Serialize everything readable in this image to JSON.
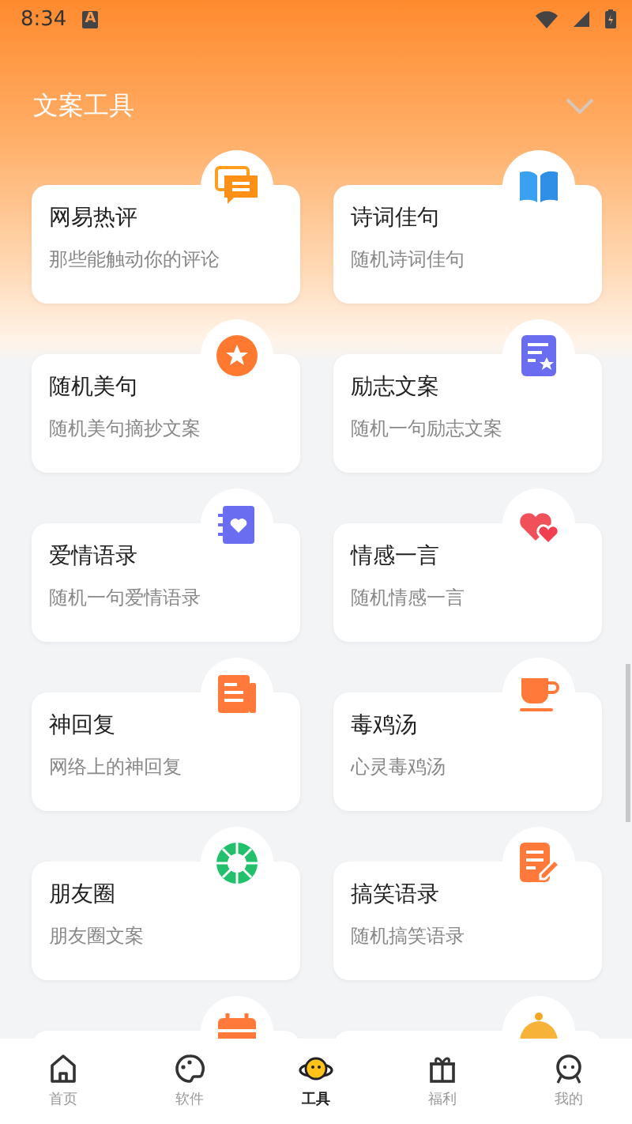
{
  "status_bar": {
    "time": "8:34",
    "notification": "A"
  },
  "header": {
    "title": "文案工具",
    "expanded": false
  },
  "cards": [
    {
      "kind": "full",
      "title": "网易热评",
      "subtitle": "那些能触动你的评论"
    },
    {
      "kind": "full",
      "title": "诗词佳句",
      "subtitle": "随机诗词佳句"
    },
    {
      "kind": "full",
      "title": "随机美句",
      "subtitle": "随机美句摘抄文案"
    },
    {
      "kind": "full",
      "title": "励志文案",
      "subtitle": "随机一句励志文案"
    },
    {
      "kind": "full",
      "title": "爱情语录",
      "subtitle": "随机一句爱情语录"
    },
    {
      "kind": "full",
      "title": "情感一言",
      "subtitle": "随机情感一言"
    },
    {
      "kind": "full",
      "title": "神回复",
      "subtitle": "网络上的神回复"
    },
    {
      "kind": "full",
      "title": "毒鸡汤",
      "subtitle": "心灵毒鸡汤"
    },
    {
      "kind": "full",
      "title": "朋友圈",
      "subtitle": "朋友圈文案"
    },
    {
      "kind": "full",
      "title": "搞笑语录",
      "subtitle": "随机搞笑语录"
    },
    {
      "kind": "partial"
    },
    {
      "kind": "partial"
    }
  ],
  "nav": [
    {
      "label": "首页",
      "selected": false
    },
    {
      "label": "软件",
      "selected": false
    },
    {
      "label": "工具",
      "selected": true
    },
    {
      "label": "福利",
      "selected": false
    },
    {
      "label": "我的",
      "selected": false
    }
  ]
}
